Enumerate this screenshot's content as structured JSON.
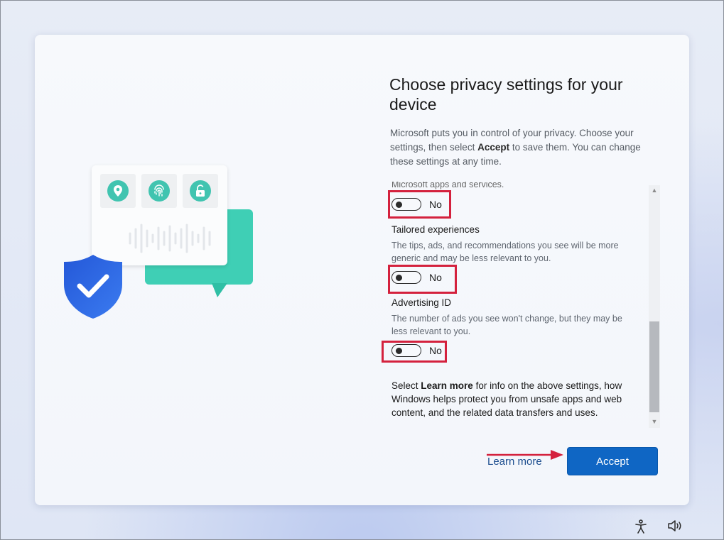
{
  "page": {
    "title": "Choose privacy settings for your device",
    "intro_pre": "Microsoft puts you in control of your privacy. Choose your settings, then select ",
    "intro_bold": "Accept",
    "intro_post": " to save them. You can change these settings at any time."
  },
  "settings": {
    "clipped_text": "Microsoft apps and services.",
    "toggle_state_label": "No",
    "items": [
      {
        "title": "Tailored experiences",
        "description": "The tips, ads, and recommendations you see will be more generic and may be less relevant to you."
      },
      {
        "title": "Advertising ID",
        "description": "The number of ads you see won't change, but they may be less relevant to you."
      }
    ]
  },
  "footer": {
    "pre": "Select ",
    "bold": "Learn more",
    "post": " for info on the above settings, how Windows helps protect you from unsafe apps and web content, and the related data transfers and uses."
  },
  "buttons": {
    "learn_more": "Learn more",
    "accept": "Accept"
  },
  "icons": {
    "illustration": [
      "location-icon",
      "fingerprint-icon",
      "unlock-icon",
      "shield-check-icon"
    ],
    "system_tray": [
      "accessibility-icon",
      "volume-icon"
    ]
  },
  "colors": {
    "accent": "#0f66c4",
    "annotation": "#d4213d",
    "illustration_teal": "#3fcfb5",
    "shield_blue": "#2f5fe0"
  }
}
